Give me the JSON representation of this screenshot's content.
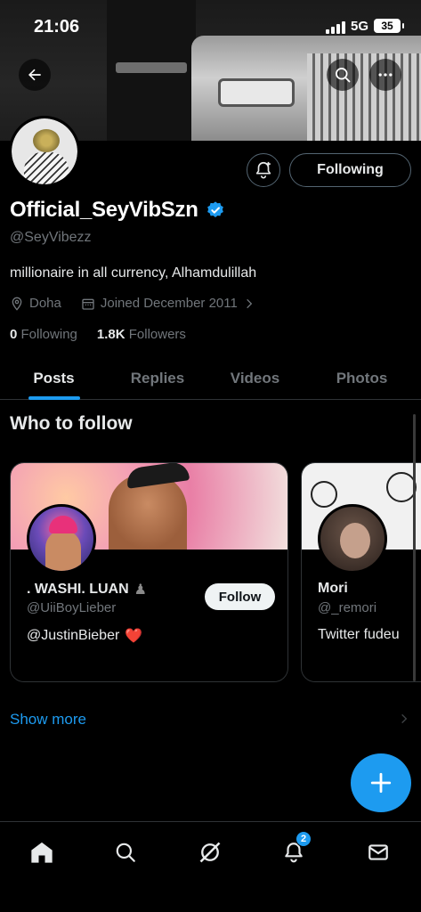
{
  "status_bar": {
    "time": "21:06",
    "network": "5G",
    "battery": "35"
  },
  "profile": {
    "display_name": "Official_SeyVibSzn",
    "verified": true,
    "handle": "@SeyVibezz",
    "bio": "millionaire in all currency, Alhamdulillah",
    "location": "Doha",
    "joined": "Joined December 2011",
    "following_count": "0",
    "following_label": "Following",
    "followers_count": "1.8K",
    "followers_label": "Followers"
  },
  "actions": {
    "following_button": "Following",
    "notify_icon": "bell-plus-icon"
  },
  "tabs": [
    {
      "label": "Posts",
      "active": true
    },
    {
      "label": "Replies",
      "active": false
    },
    {
      "label": "Videos",
      "active": false
    },
    {
      "label": "Photos",
      "active": false
    }
  ],
  "who_to_follow": {
    "title": "Who to follow",
    "cards": [
      {
        "name": ". WASHI. LUAN",
        "name_emoji": "♟",
        "handle": "@UiiBoyLieber",
        "bio": "@JustinBieber",
        "bio_emoji": "❤️",
        "follow_label": "Follow"
      },
      {
        "name": "Mori",
        "handle": "@_remori",
        "bio": "Twitter fudeu"
      }
    ],
    "show_more": "Show more"
  },
  "bottom_nav": {
    "notifications_badge": "2",
    "items": [
      "home-icon",
      "search-icon",
      "grok-icon",
      "notifications-icon",
      "messages-icon"
    ]
  },
  "colors": {
    "accent": "#1d9bf0",
    "background": "#000000",
    "muted_text": "#71767b",
    "border": "#2f3336"
  }
}
